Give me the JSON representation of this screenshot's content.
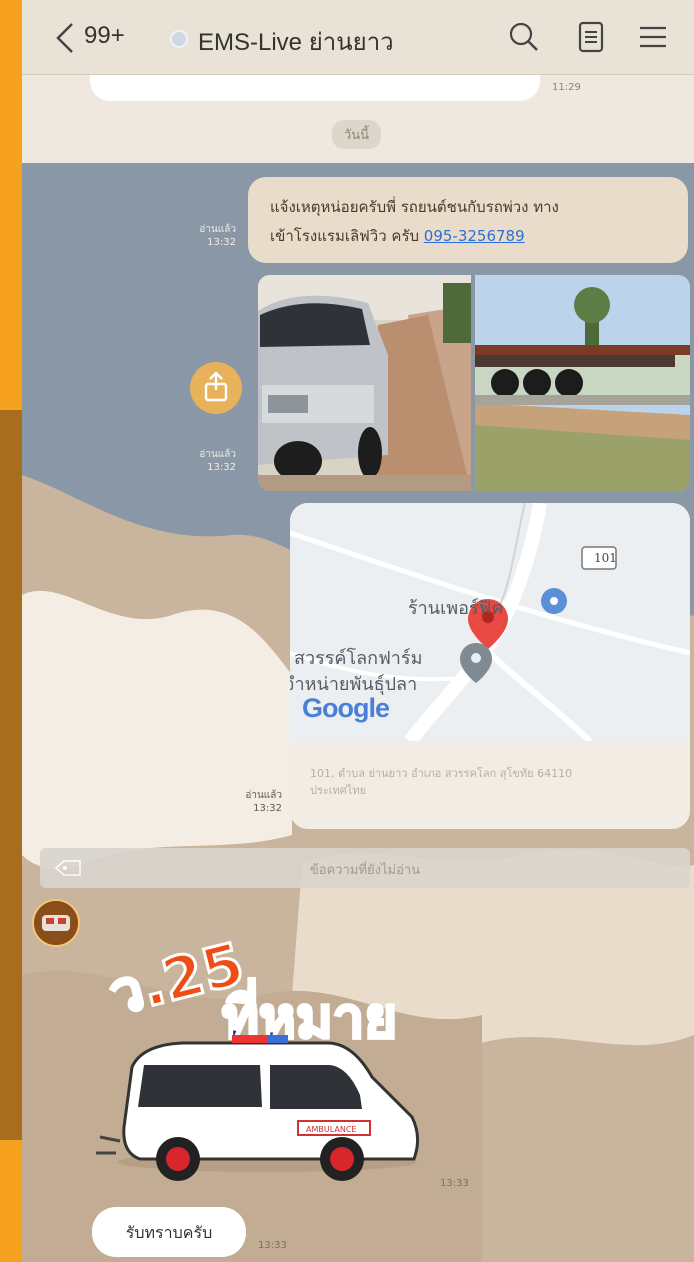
{
  "header": {
    "back_count": "99+",
    "room_title": "EMS-Live ย่านยาว",
    "icons": [
      "chevron-left-icon",
      "search-icon",
      "notes-icon",
      "menu-icon"
    ]
  },
  "chat": {
    "previous_message": {
      "time": "11:29"
    },
    "date_chip": "วันนี้",
    "outgoing_text": {
      "line1": "แจ้งเหตุหน่อยครับพี่ รถยนต์ชนกับรถพ่วง ทาง",
      "line2": "เข้าโรงแรมเลิฟวิว ครับ ",
      "phone": "095-3256789",
      "read": "อ่านแล้ว",
      "time": "13:32"
    },
    "outgoing_photos": {
      "read": "อ่านแล้ว",
      "time": "13:32"
    },
    "outgoing_map": {
      "road_sign": "101",
      "place_1": "ร้านเพอร์ฟิค",
      "place_2_line1": "สวรรค์โลกฟาร์ม",
      "place_2_line2": "จำหน่ายพันธุ์ปลา",
      "logo": "Google",
      "address": "101, ตำบล ย่านยาว อำเภอ สวรรคโลก สุโขทัย 64110 ประเทศไทย",
      "read": "อ่านแล้ว",
      "time": "13:32"
    },
    "unread_divider": "ข้อความที่ยังไม่อ่าน",
    "incoming_sticker": {
      "text_small": "ว.25",
      "text_big": "ที่หมาย",
      "ambulance_label": "AMBULANCE",
      "time": "13:33"
    },
    "incoming_reply": {
      "text": "รับทราบครับ",
      "time": "13:33"
    }
  },
  "colors": {
    "outer": "#f6a21e",
    "bubble": "#e9dccb",
    "link": "#2d6fd4",
    "chat_blue": "#8a97a6"
  }
}
